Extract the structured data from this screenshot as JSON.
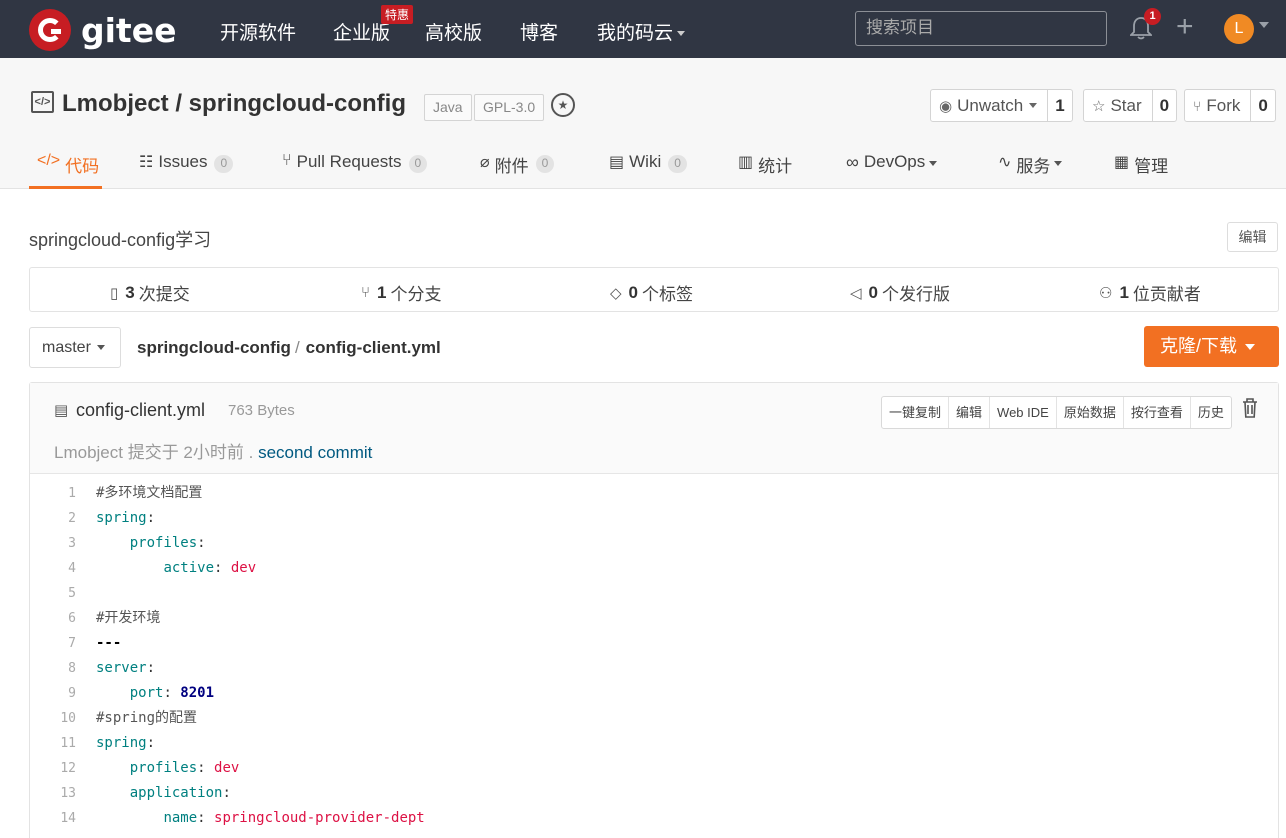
{
  "nav": {
    "logo_text": "gitee",
    "links": [
      "开源软件",
      "企业版",
      "高校版",
      "博客",
      "我的码云"
    ],
    "special_badge": "特惠",
    "search_placeholder": "搜索项目",
    "notification_count": "1",
    "avatar_letter": "L"
  },
  "repo": {
    "title": "Lmobject / springcloud-config",
    "lang_tag": "Java",
    "license_tag": "GPL-3.0",
    "watch_label": "Unwatch",
    "watch_count": "1",
    "star_label": "Star",
    "star_count": "0",
    "fork_label": "Fork",
    "fork_count": "0"
  },
  "tabs": [
    {
      "label": "代码"
    },
    {
      "label": "Issues",
      "count": "0"
    },
    {
      "label": "Pull Requests",
      "count": "0"
    },
    {
      "label": "附件",
      "count": "0"
    },
    {
      "label": "Wiki",
      "count": "0"
    },
    {
      "label": "统计"
    },
    {
      "label": "DevOps"
    },
    {
      "label": "服务"
    },
    {
      "label": "管理"
    }
  ],
  "description": "springcloud-config学习",
  "edit_label": "编辑",
  "stats": [
    {
      "num": "3",
      "label": "次提交"
    },
    {
      "num": "1",
      "label": "个分支"
    },
    {
      "num": "0",
      "label": "个标签"
    },
    {
      "num": "0",
      "label": "个发行版"
    },
    {
      "num": "1",
      "label": "位贡献者"
    }
  ],
  "branch": "master",
  "breadcrumb": {
    "repo": "springcloud-config",
    "sep": "/",
    "file": "config-client.yml"
  },
  "clone_label": "克隆/下载",
  "file": {
    "name": "config-client.yml",
    "size": "763 Bytes",
    "commit_prefix": "Lmobject 提交于 2小时前 .",
    "commit_message": "second commit",
    "buttons": [
      "一键复制",
      "编辑",
      "Web IDE",
      "原始数据",
      "按行查看",
      "历史"
    ]
  },
  "code_lines": [
    {
      "n": "1",
      "parts": [
        {
          "t": "#多环境文档配置",
          "c": "c"
        }
      ]
    },
    {
      "n": "2",
      "parts": [
        {
          "t": "spring",
          "c": "k"
        },
        {
          "t": ":",
          "c": ""
        }
      ]
    },
    {
      "n": "3",
      "parts": [
        {
          "t": "    ",
          "c": ""
        },
        {
          "t": "profiles",
          "c": "k"
        },
        {
          "t": ":",
          "c": ""
        }
      ]
    },
    {
      "n": "4",
      "parts": [
        {
          "t": "        ",
          "c": ""
        },
        {
          "t": "active",
          "c": "k"
        },
        {
          "t": ": ",
          "c": ""
        },
        {
          "t": "dev",
          "c": "s"
        }
      ]
    },
    {
      "n": "5",
      "parts": []
    },
    {
      "n": "6",
      "parts": [
        {
          "t": "#开发环境",
          "c": "c"
        }
      ]
    },
    {
      "n": "7",
      "parts": [
        {
          "t": "---",
          "c": "b"
        }
      ]
    },
    {
      "n": "8",
      "parts": [
        {
          "t": "server",
          "c": "k"
        },
        {
          "t": ":",
          "c": ""
        }
      ]
    },
    {
      "n": "9",
      "parts": [
        {
          "t": "    ",
          "c": ""
        },
        {
          "t": "port",
          "c": "k"
        },
        {
          "t": ": ",
          "c": ""
        },
        {
          "t": "8201",
          "c": "n"
        }
      ]
    },
    {
      "n": "10",
      "parts": [
        {
          "t": "#spring的配置",
          "c": "c"
        }
      ]
    },
    {
      "n": "11",
      "parts": [
        {
          "t": "spring",
          "c": "k"
        },
        {
          "t": ":",
          "c": ""
        }
      ]
    },
    {
      "n": "12",
      "parts": [
        {
          "t": "    ",
          "c": ""
        },
        {
          "t": "profiles",
          "c": "k"
        },
        {
          "t": ": ",
          "c": ""
        },
        {
          "t": "dev",
          "c": "s"
        }
      ]
    },
    {
      "n": "13",
      "parts": [
        {
          "t": "    ",
          "c": ""
        },
        {
          "t": "application",
          "c": "k"
        },
        {
          "t": ":",
          "c": ""
        }
      ]
    },
    {
      "n": "14",
      "parts": [
        {
          "t": "        ",
          "c": ""
        },
        {
          "t": "name",
          "c": "k"
        },
        {
          "t": ": ",
          "c": ""
        },
        {
          "t": "springcloud-provider-dept",
          "c": "s"
        }
      ]
    }
  ]
}
